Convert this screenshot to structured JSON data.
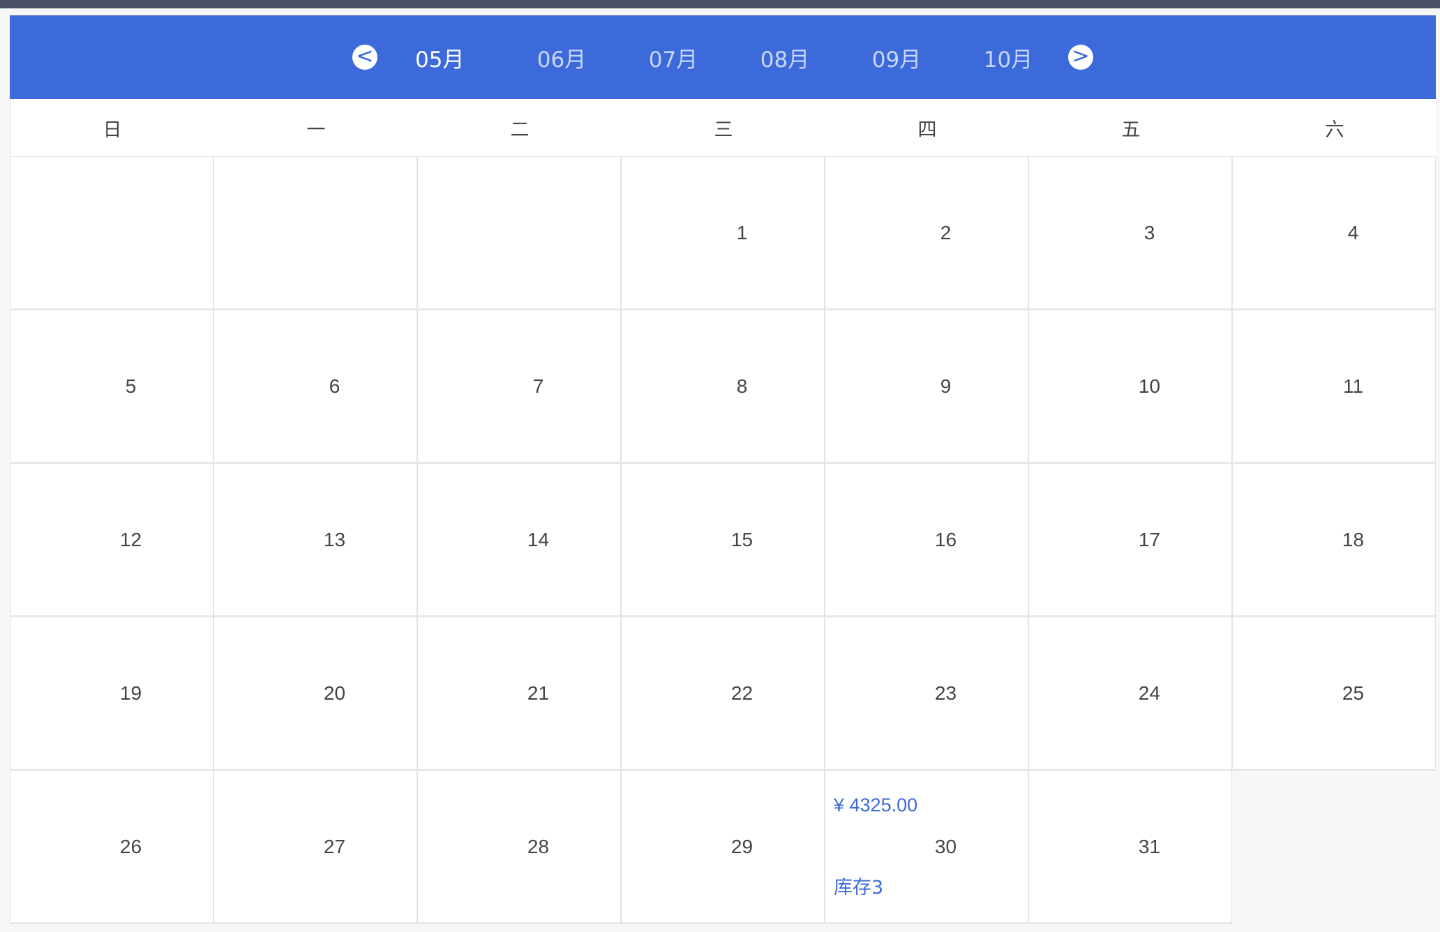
{
  "header": {
    "prev_label": "<",
    "next_label": ">",
    "months": [
      "05月",
      "06月",
      "07月",
      "08月",
      "09月",
      "10月"
    ],
    "active_month_index": 0
  },
  "weekdays": [
    "日",
    "一",
    "二",
    "三",
    "四",
    "五",
    "六"
  ],
  "weeks": [
    [
      "",
      "",
      "",
      "1",
      "2",
      "3",
      "4"
    ],
    [
      "5",
      "6",
      "7",
      "8",
      "9",
      "10",
      "11"
    ],
    [
      "12",
      "13",
      "14",
      "15",
      "16",
      "17",
      "18"
    ],
    [
      "19",
      "20",
      "21",
      "22",
      "23",
      "24",
      "25"
    ],
    [
      "26",
      "27",
      "28",
      "29",
      "30",
      "31",
      null
    ]
  ],
  "special_day": {
    "day": "30",
    "price": "¥ 4325.00",
    "stock": "库存3"
  },
  "colors": {
    "accent": "#3c6adb",
    "top_strip": "#4a5068"
  }
}
